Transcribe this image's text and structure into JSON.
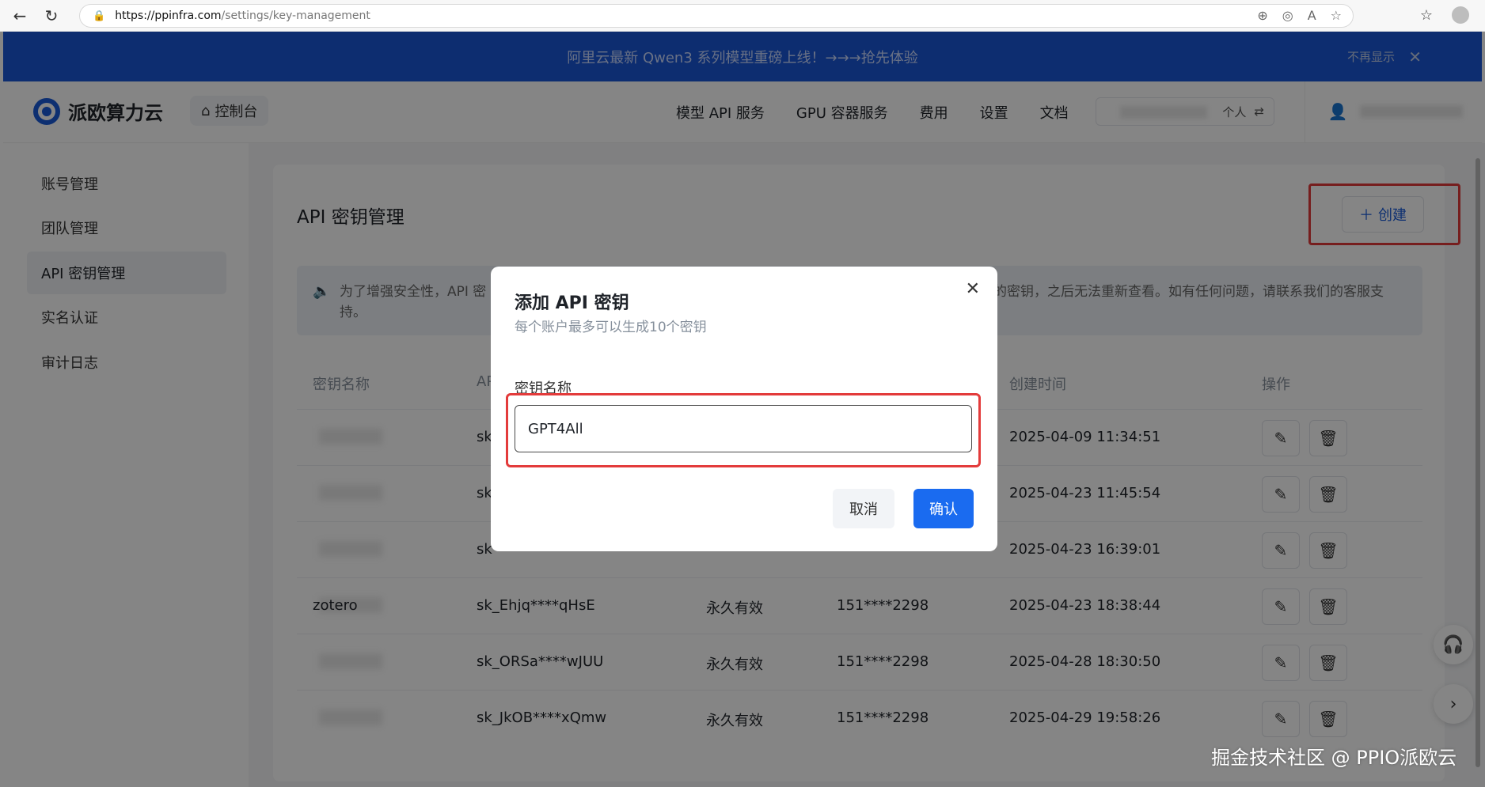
{
  "browser": {
    "url_host": "https://ppinfra.com",
    "url_path": "/settings/key-management"
  },
  "announcement": {
    "text": "阿里云最新 Qwen3 系列模型重磅上线！→→→抢先体验",
    "hide_label": "不再显示"
  },
  "header": {
    "brand": "派欧算力云",
    "console_label": "控制台",
    "nav": [
      "模型 API 服务",
      "GPU 容器服务",
      "费用",
      "设置",
      "文档"
    ],
    "account_type": "个人"
  },
  "sidebar": {
    "items": [
      {
        "label": "账号管理"
      },
      {
        "label": "团队管理"
      },
      {
        "label": "API 密钥管理"
      },
      {
        "label": "实名认证"
      },
      {
        "label": "审计日志"
      }
    ]
  },
  "main": {
    "title": "API 密钥管理",
    "create_label": "创建",
    "notice_left": "为了增强安全性，API 密",
    "notice_right": "的密钥，之后无法重新查看。如有任何问题，请联系我们的客服支",
    "notice_line2": "持。",
    "columns": [
      "密钥名称",
      "AP",
      "创建时间",
      "操作"
    ],
    "rows": [
      {
        "name": "",
        "key": "sk",
        "validity": "",
        "creator": "",
        "created": "2025-04-09 11:34:51"
      },
      {
        "name": "",
        "key": "sk",
        "validity": "",
        "creator": "",
        "created": "2025-04-23 11:45:54"
      },
      {
        "name": "",
        "key": "sk",
        "validity": "",
        "creator": "",
        "created": "2025-04-23 16:39:01"
      },
      {
        "name": "zotero",
        "key": "sk_Ehjq****qHsE",
        "validity": "永久有效",
        "creator": "151****2298",
        "created": "2025-04-23 18:38:44"
      },
      {
        "name": "",
        "key": "sk_ORSa****wJUU",
        "validity": "永久有效",
        "creator": "151****2298",
        "created": "2025-04-28 18:30:50"
      },
      {
        "name": "",
        "key": "sk_JkOB****xQmw",
        "validity": "永久有效",
        "creator": "151****2298",
        "created": "2025-04-29 19:58:26"
      }
    ]
  },
  "modal": {
    "title": "添加 API 密钥",
    "subtitle": "每个账户最多可以生成10个密钥",
    "field_label": "密钥名称",
    "field_value": "GPT4All",
    "cancel_label": "取消",
    "confirm_label": "确认"
  },
  "watermark": "掘金技术社区 @ PPIO派欧云",
  "colors": {
    "accent": "#1a6bf0",
    "announcement_bg": "#1a56d6",
    "highlight": "#e33b3b"
  }
}
